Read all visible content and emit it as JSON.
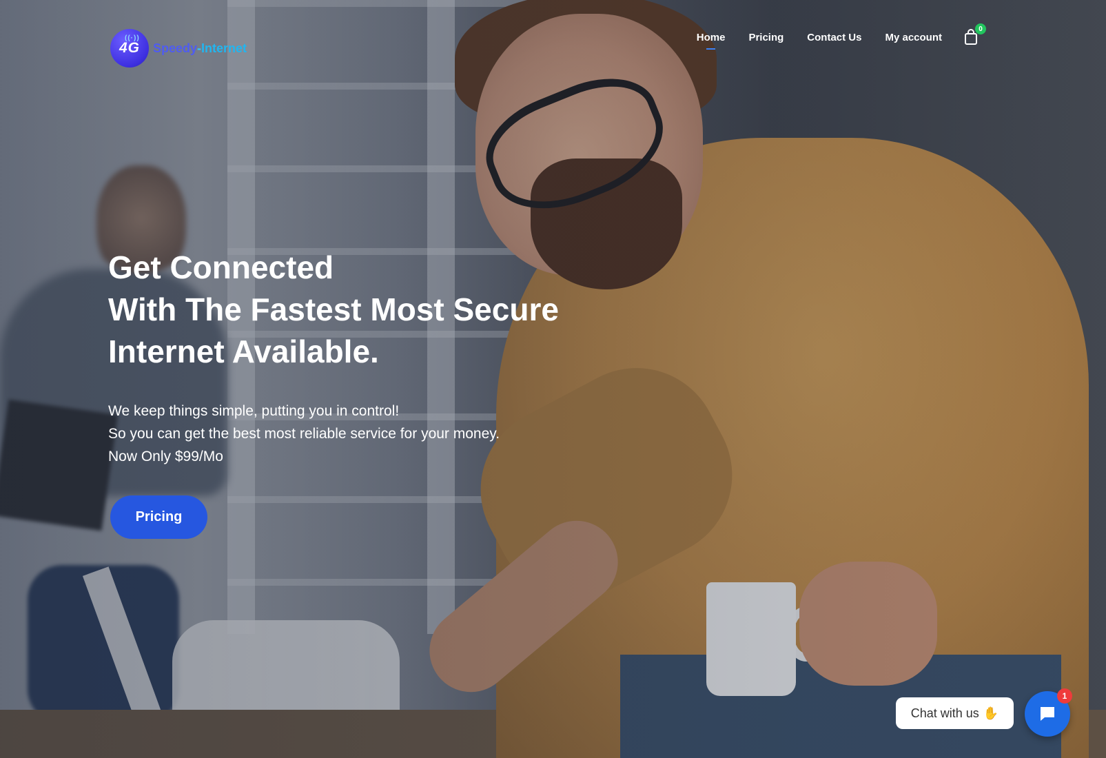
{
  "brand": {
    "badge_text": "4G",
    "name_part1": "Speedy",
    "name_sep": "-",
    "name_part2": "Internet",
    "colors": {
      "badge": "#3d2fe0",
      "name_primary": "#4f5cf0",
      "name_secondary": "#21b6f0"
    }
  },
  "nav": {
    "items": [
      {
        "label": "Home",
        "active": true
      },
      {
        "label": "Pricing",
        "active": false
      },
      {
        "label": "Contact Us",
        "active": false
      },
      {
        "label": "My account",
        "active": false
      }
    ],
    "cart": {
      "icon": "shopping-bag-icon",
      "count": "0"
    }
  },
  "hero": {
    "title_lines": [
      "Get Connected",
      "With The Fastest Most Secure",
      "Internet Available."
    ],
    "subtitle_lines": [
      "We keep things simple, putting you in control!",
      "So you can get the best most reliable service for your money.",
      "Now Only $99/Mo"
    ],
    "cta_label": "Pricing",
    "accent_color": "#2657e0"
  },
  "chat": {
    "prompt": "Chat with us",
    "wave_icon": "waving-hand-icon",
    "button_icon": "chat-bubble-icon",
    "badge_count": "1"
  }
}
